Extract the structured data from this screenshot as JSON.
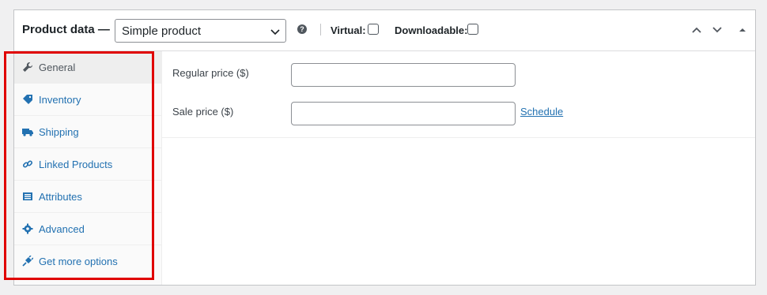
{
  "header": {
    "title": "Product data —",
    "product_type": "Simple product",
    "help": "?",
    "virtual_label": "Virtual:",
    "downloadable_label": "Downloadable:"
  },
  "sidebar": {
    "items": [
      {
        "label": "General",
        "icon": "wrench-icon",
        "active": true
      },
      {
        "label": "Inventory",
        "icon": "tag-icon"
      },
      {
        "label": "Shipping",
        "icon": "truck-icon"
      },
      {
        "label": "Linked Products",
        "icon": "link-icon"
      },
      {
        "label": "Attributes",
        "icon": "list-icon"
      },
      {
        "label": "Advanced",
        "icon": "gear-icon"
      },
      {
        "label": "Get more options",
        "icon": "plugin-icon"
      }
    ]
  },
  "general": {
    "regular_price_label": "Regular price ($)",
    "regular_price_value": "",
    "sale_price_label": "Sale price ($)",
    "sale_price_value": "",
    "schedule_link": "Schedule"
  },
  "colors": {
    "link": "#2271b1",
    "highlight": "#e00000"
  }
}
